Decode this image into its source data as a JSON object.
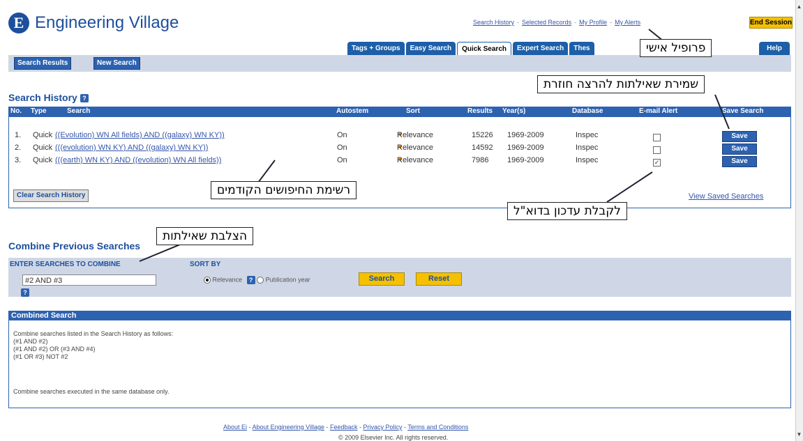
{
  "brand": {
    "logo_letter": "E",
    "name": "Engineering Village"
  },
  "top_links": {
    "search_history": "Search History",
    "selected_records": "Selected Records",
    "my_profile": "My Profile",
    "my_alerts": "My Alerts",
    "separator": "-"
  },
  "end_session": "End Session",
  "tabs": [
    "Tags + Groups",
    "Easy Search",
    "Quick Search",
    "Expert Search",
    "Thes",
    "Help"
  ],
  "nav": {
    "search_results": "Search Results",
    "new_search": "New Search"
  },
  "history": {
    "title": "Search History",
    "help": "?",
    "columns": {
      "no": "No.",
      "type": "Type",
      "search": "Search",
      "autostem": "Autostem",
      "sort": "Sort",
      "results": "Results",
      "years": "Year(s)",
      "database": "Database",
      "email_alert": "E-mail Alert",
      "save_search": "Save Search"
    },
    "rows": [
      {
        "no": "1.",
        "type": "Quick",
        "search": "((Evolution) WN All fields) AND ((galaxy) WN KY))",
        "autostem": "On",
        "sort": "Relevance",
        "results": "15226",
        "years": "1969-2009",
        "database": "Inspec",
        "alert": false,
        "save": "Save"
      },
      {
        "no": "2.",
        "type": "Quick",
        "search": "(((evolution) WN KY) AND ((galaxy) WN KY))",
        "autostem": "On",
        "sort": "Relevance",
        "results": "14592",
        "years": "1969-2009",
        "database": "Inspec",
        "alert": false,
        "save": "Save"
      },
      {
        "no": "3.",
        "type": "Quick",
        "search": "(((earth) WN KY) AND ((evolution) WN All fields))",
        "autostem": "On",
        "sort": "Relevance",
        "results": "7986",
        "years": "1969-2009",
        "database": "Inspec",
        "alert": true,
        "save": "Save"
      }
    ],
    "clear_button": "Clear Search History",
    "view_saved": "View Saved Searches"
  },
  "callouts": {
    "profile": "פרופיל אישי",
    "save_queries": "שמירת שאילתות להרצה חוזרת",
    "previous_searches": "רשימת החיפושים הקודמים",
    "email_update": "לקבלת עדכון בדוא\"ל",
    "combine_queries": "הצלבת שאילתות"
  },
  "combine": {
    "title": "Combine Previous Searches",
    "enter_label": "ENTER SEARCHES TO COMBINE",
    "input_value": "#2 AND #3",
    "sort_label": "SORT BY",
    "sort_options": [
      "Relevance",
      "Publication year"
    ],
    "search_button": "Search",
    "reset_button": "Reset"
  },
  "combined_search": {
    "header": "Combined Search",
    "lines": [
      "Combine searches listed in the Search History as follows:",
      "(#1 AND #2)",
      "(#1 AND #2) OR (#3 AND #4)",
      "(#1 OR #3) NOT #2"
    ],
    "note": "Combine searches executed in the same database only."
  },
  "footer": {
    "links": [
      "About Ei",
      "About Engineering Village",
      "Feedback",
      "Privacy Policy",
      "Terms and Conditions"
    ],
    "copyright": "© 2009 Elsevier Inc. All rights reserved."
  }
}
